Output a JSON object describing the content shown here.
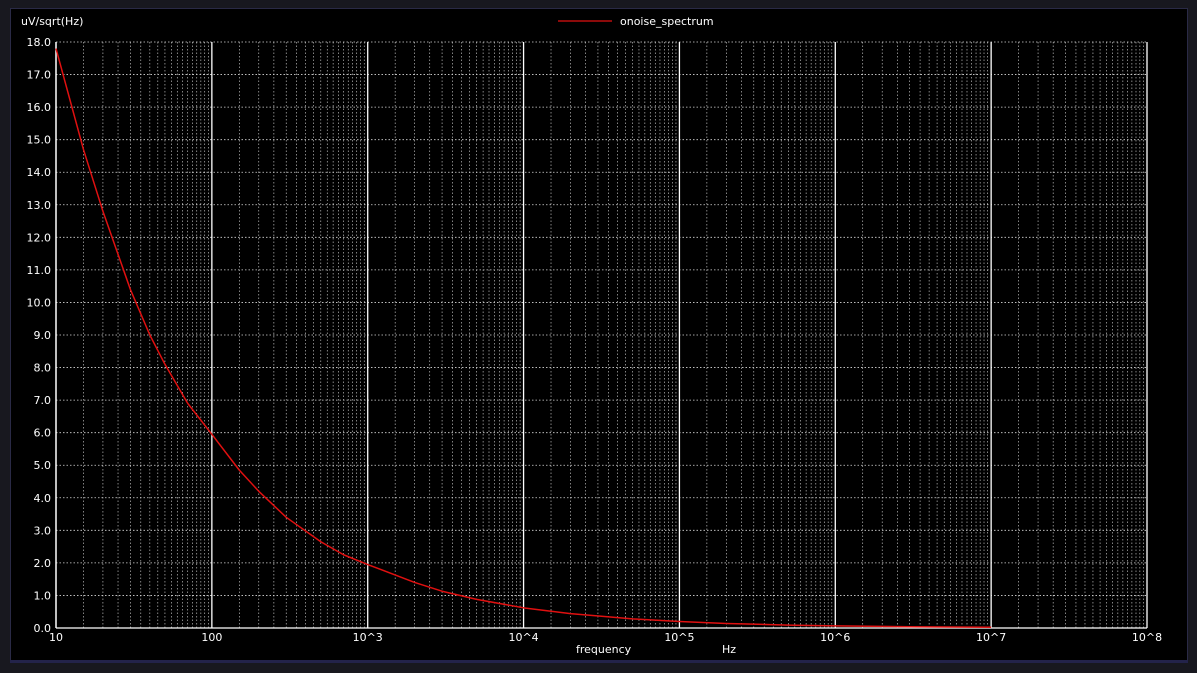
{
  "chart_data": {
    "type": "line",
    "ylabel": "uV/sqrt(Hz)",
    "xlabel": "frequency",
    "xunit": "Hz",
    "legend": "top-center",
    "grid": true,
    "xscale": "log",
    "xlim": [
      10,
      100000000
    ],
    "ylim": [
      0,
      18
    ],
    "x_ticks": [
      {
        "value": 10,
        "label": "10"
      },
      {
        "value": 100,
        "label": "100"
      },
      {
        "value": 1000,
        "label": "10^3"
      },
      {
        "value": 10000,
        "label": "10^4"
      },
      {
        "value": 100000,
        "label": "10^5"
      },
      {
        "value": 1000000,
        "label": "10^6"
      },
      {
        "value": 10000000,
        "label": "10^7"
      },
      {
        "value": 100000000,
        "label": "10^8"
      }
    ],
    "y_ticks": [
      {
        "value": 0,
        "label": "0.0"
      },
      {
        "value": 1,
        "label": "1.0"
      },
      {
        "value": 2,
        "label": "2.0"
      },
      {
        "value": 3,
        "label": "3.0"
      },
      {
        "value": 4,
        "label": "4.0"
      },
      {
        "value": 5,
        "label": "5.0"
      },
      {
        "value": 6,
        "label": "6.0"
      },
      {
        "value": 7,
        "label": "7.0"
      },
      {
        "value": 8,
        "label": "8.0"
      },
      {
        "value": 9,
        "label": "9.0"
      },
      {
        "value": 10,
        "label": "10.0"
      },
      {
        "value": 11,
        "label": "11.0"
      },
      {
        "value": 12,
        "label": "12.0"
      },
      {
        "value": 13,
        "label": "13.0"
      },
      {
        "value": 14,
        "label": "14.0"
      },
      {
        "value": 15,
        "label": "15.0"
      },
      {
        "value": 16,
        "label": "16.0"
      },
      {
        "value": 17,
        "label": "17.0"
      },
      {
        "value": 18,
        "label": "18.0"
      }
    ],
    "series": [
      {
        "name": "onoise_spectrum",
        "color": "#e01010",
        "x": [
          10,
          15,
          20,
          30,
          40,
          50,
          70,
          100,
          150,
          200,
          300,
          500,
          700,
          1000,
          2000,
          3000,
          5000,
          10000,
          20000,
          50000,
          100000,
          200000,
          500000,
          1000000,
          3000000,
          10000000
        ],
        "y": [
          17.8,
          14.7,
          12.8,
          10.4,
          9.0,
          8.1,
          6.9,
          5.95,
          4.85,
          4.2,
          3.4,
          2.65,
          2.25,
          1.95,
          1.4,
          1.13,
          0.88,
          0.62,
          0.44,
          0.28,
          0.2,
          0.14,
          0.09,
          0.065,
          0.04,
          0.025
        ]
      }
    ]
  }
}
